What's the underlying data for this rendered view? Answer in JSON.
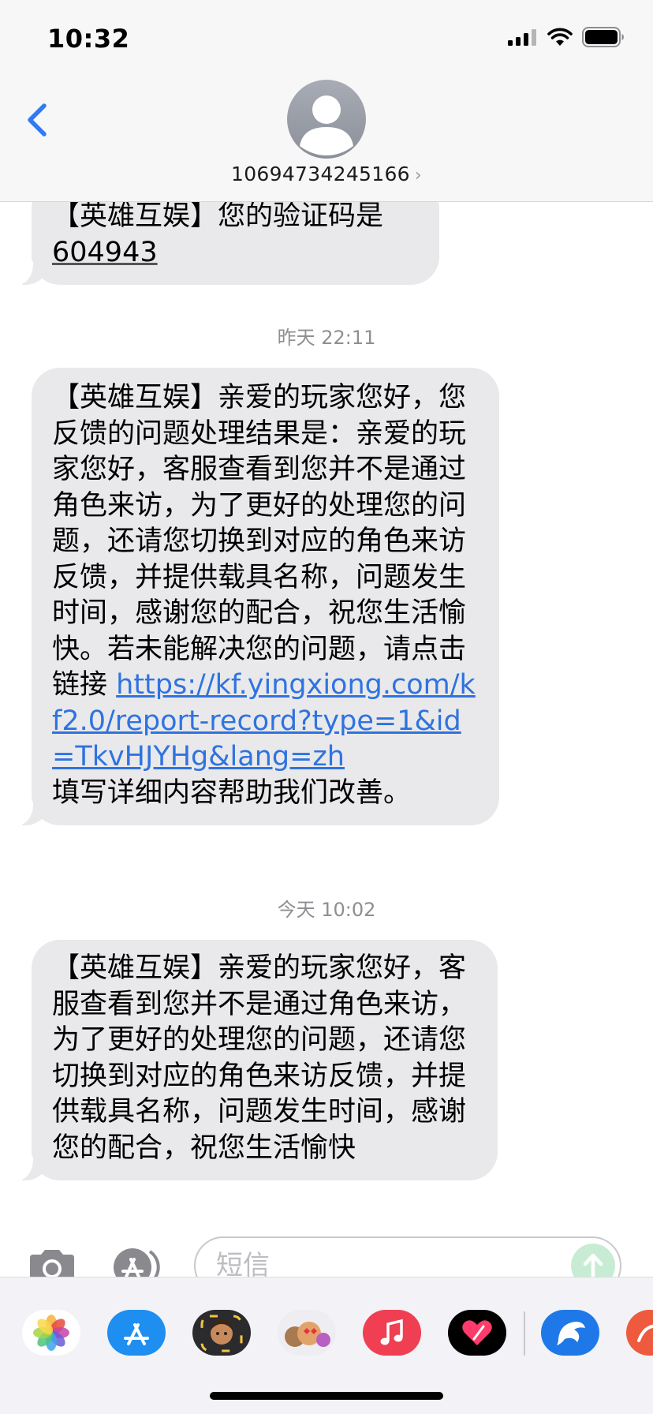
{
  "status_bar": {
    "time": "10:32"
  },
  "header": {
    "contact": "10694734245166",
    "chevron": "›",
    "back_icon": "chevron-left-icon"
  },
  "messages": [
    {
      "text": "【英雄互娱】您的验证码是",
      "code": "604943"
    },
    {
      "timestamp": "昨天 22:11",
      "text_before_link": "【英雄互娱】亲爱的玩家您好，您反馈的问题处理结果是：亲爱的玩家您好，客服查看到您并不是通过角色来访，为了更好的处理您的问题，还请您切换到对应的角色来访反馈，并提供载具名称，问题发生时间，感谢您的配合，祝您生活愉快。若未能解决您的问题，请点击链接 ",
      "link": "https://kf.yingxiong.com/kf2.0/report-record?type=1&id=TkvHJYHg&lang=zh",
      "text_after_link": "填写详细内容帮助我们改善。"
    },
    {
      "timestamp": "今天 10:02",
      "text": "【英雄互娱】亲爱的玩家您好，客服查看到您并不是通过角色来访，为了更好的处理您的问题，还请您切换到对应的角色来访反馈，并提供载具名称，问题发生时间，感谢您的配合，祝您生活愉快"
    }
  ],
  "composer": {
    "placeholder": "短信",
    "camera_icon": "camera-icon",
    "apps_icon": "app-store-icon",
    "send_icon": "arrow-up-icon"
  },
  "app_drawer": {
    "apps": [
      "photos-icon",
      "app-store-icon",
      "memoji-icon",
      "animoji-icon",
      "music-icon",
      "digital-touch-icon",
      "dolphin-app-icon",
      "partial-app-icon"
    ]
  },
  "colors": {
    "bubble": "#e9e9eb",
    "link": "#2f73e0",
    "accent_blue": "#2f7bf5",
    "send_disabled": "#c8ecd3"
  }
}
